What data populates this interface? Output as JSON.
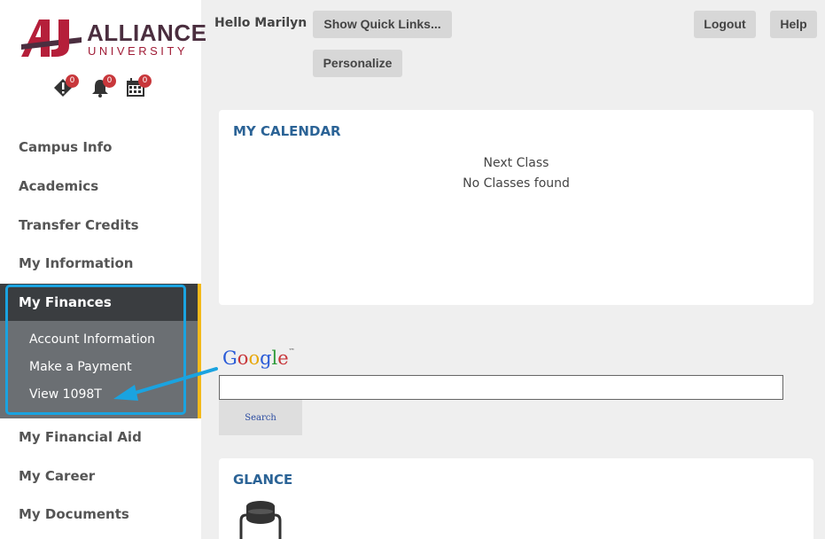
{
  "logo": {
    "name": "ALLIANCE",
    "sub": "UNIVERSITY"
  },
  "notifications": {
    "alerts": "0",
    "bell": "0",
    "calendar": "0"
  },
  "nav": {
    "campus_info": "Campus Info",
    "academics": "Academics",
    "transfer_credits": "Transfer Credits",
    "my_information": "My Information",
    "my_finances": "My Finances",
    "finance_items": [
      "Account Information",
      "Make a Payment",
      "View 1098T"
    ],
    "my_financial_aid": "My Financial Aid",
    "my_career": "My Career",
    "my_documents": "My Documents"
  },
  "header": {
    "greeting": "Hello Marilyn",
    "quick_links": "Show Quick Links...",
    "personalize": "Personalize",
    "logout": "Logout",
    "help": "Help"
  },
  "calendar": {
    "title": "MY CALENDAR",
    "next_class": "Next Class",
    "no_classes": "No Classes found"
  },
  "search": {
    "button": "Search"
  },
  "glance": {
    "title": "GLANCE"
  },
  "colors": {
    "accent_blue": "#1aa3e0",
    "title_blue": "#2b6396",
    "gold": "#f3b91b",
    "badge_red": "#c8373b"
  }
}
